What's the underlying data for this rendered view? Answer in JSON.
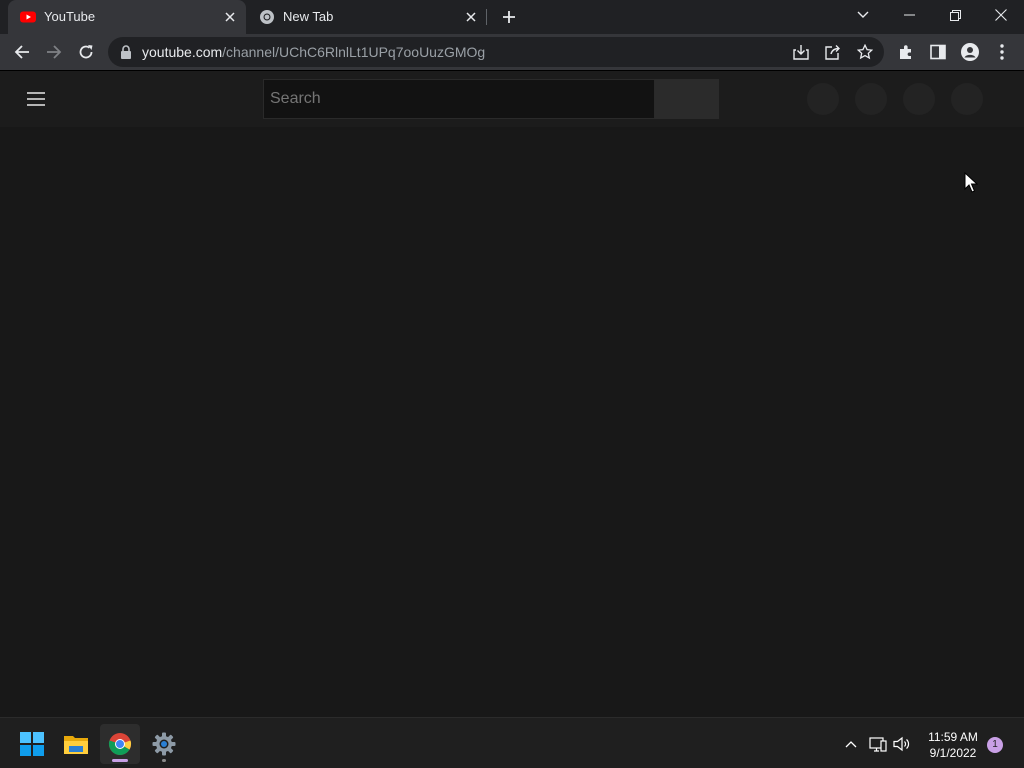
{
  "browser": {
    "tabs": [
      {
        "title": "YouTube",
        "favicon": "youtube-logo-icon",
        "active": true
      },
      {
        "title": "New Tab",
        "favicon": "chrome-logo-icon",
        "active": false
      }
    ],
    "address": {
      "host": "youtube.com",
      "path": "/channel/UChC6RlnlLt1UPq7ooUuzGMOg"
    }
  },
  "page": {
    "search_placeholder": "Search"
  },
  "taskbar": {
    "time": "11:59 AM",
    "date": "9/1/2022",
    "notification_count": "1"
  },
  "colors": {
    "chrome_tabstrip": "#202124",
    "chrome_toolbar": "#35363a",
    "omnibox": "#202124",
    "page_background": "#181818",
    "youtube_red": "#ff0000",
    "taskbar_background": "#1f1f1f",
    "accent_purple": "#c9a0e6"
  }
}
